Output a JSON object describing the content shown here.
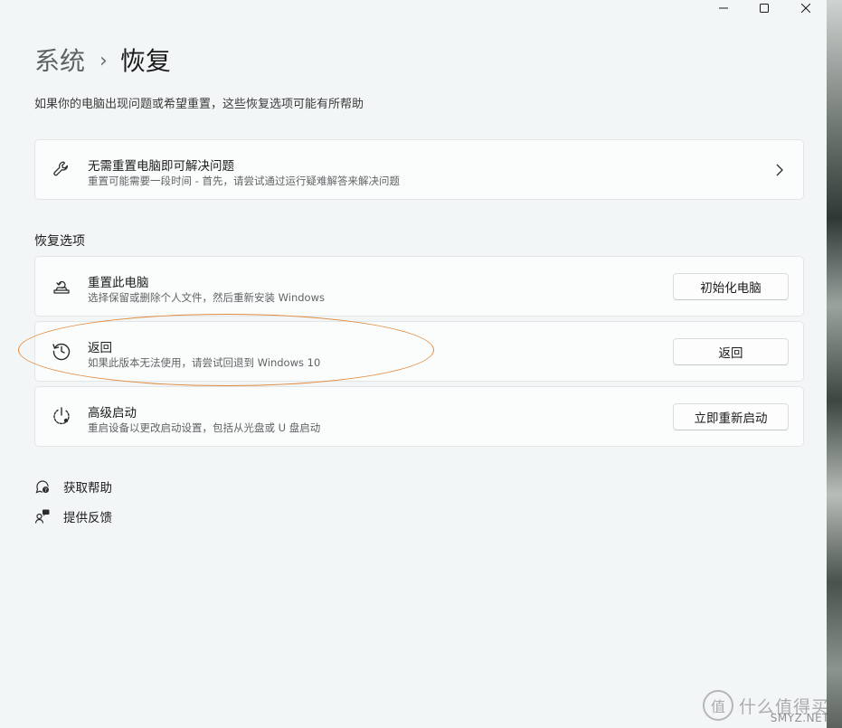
{
  "window": {
    "breadcrumb_parent": "系统",
    "breadcrumb_separator": "›",
    "breadcrumb_current": "恢复",
    "subtitle": "如果你的电脑出现问题或希望重置，这些恢复选项可能有所帮助"
  },
  "troubleshoot_card": {
    "title": "无需重置电脑即可解决问题",
    "desc": "重置可能需要一段时间 - 首先，请尝试通过运行疑难解答来解决问题",
    "icon": "wrench-icon"
  },
  "recovery_section": {
    "title": "恢复选项",
    "items": [
      {
        "title": "重置此电脑",
        "desc": "选择保留或删除个人文件，然后重新安装 Windows",
        "button": "初始化电脑",
        "icon": "reset-pc-icon"
      },
      {
        "title": "返回",
        "desc": "如果此版本无法使用，请尝试回退到 Windows 10",
        "button": "返回",
        "icon": "history-icon"
      },
      {
        "title": "高级启动",
        "desc": "重启设备以更改启动设置，包括从光盘或 U 盘启动",
        "button": "立即重新启动",
        "icon": "advanced-startup-icon"
      }
    ]
  },
  "links": [
    {
      "label": "获取帮助",
      "icon": "help-icon"
    },
    {
      "label": "提供反馈",
      "icon": "feedback-icon"
    }
  ],
  "watermark": {
    "logo_text": "值",
    "text": "什么值得买",
    "sub": "SMYZ.NET"
  },
  "colors": {
    "window_bg": "#f3f6f7",
    "card_bg": "#fbfcfc",
    "highlight": "#e08a3c"
  }
}
